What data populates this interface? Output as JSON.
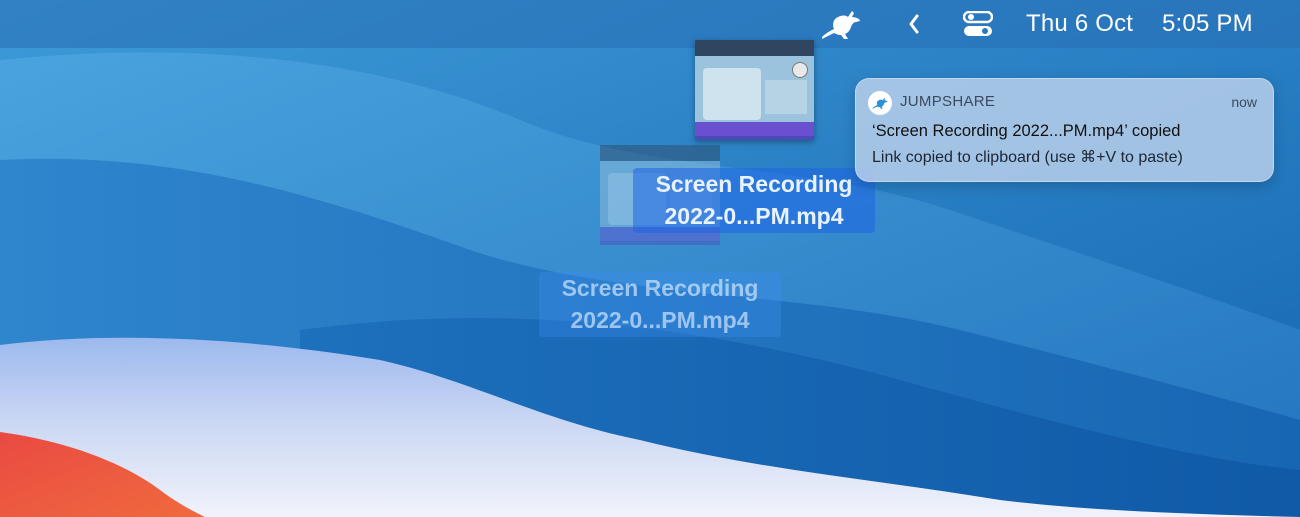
{
  "menubar": {
    "app_icon": "kangaroo-icon",
    "chevron_icon": "chevron-left-icon",
    "control_center_icon": "control-center-icon",
    "date": "Thu 6 Oct",
    "time": "5:05 PM"
  },
  "drag": {
    "label_line1": "Screen Recording",
    "label_line2": "2022-0...PM.mp4",
    "ghost_label_line1": "Screen Recording",
    "ghost_label_line2": "2022-0...PM.mp4"
  },
  "notification": {
    "app_name": "JUMPSHARE",
    "time": "now",
    "title": "‘Screen Recording 2022...PM.mp4’ copied",
    "body": "Link copied to clipboard (use ⌘+V to paste)"
  },
  "colors": {
    "wallpaper_blue": "#1f6fbf",
    "label_highlight": "#1e64e6",
    "notification_bg": "#bed2eb"
  }
}
